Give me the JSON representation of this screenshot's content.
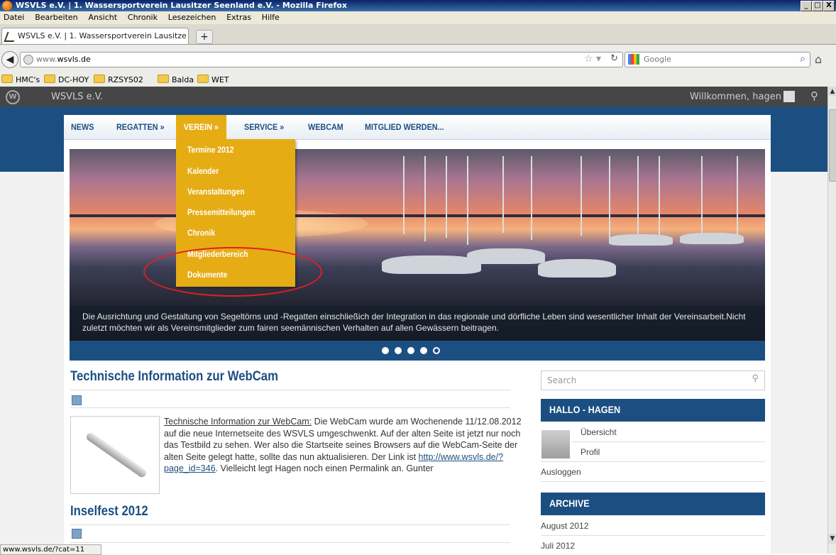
{
  "window": {
    "title": "WSVLS e.V. | 1. Wassersportverein Lausitzer Seenland e.V. - Mozilla Firefox",
    "controls": [
      "_",
      "□",
      "X"
    ]
  },
  "menubar": [
    "Datei",
    "Bearbeiten",
    "Ansicht",
    "Chronik",
    "Lesezeichen",
    "Extras",
    "Hilfe"
  ],
  "tab": {
    "label": "WSVLS e.V. | 1. Wassersportverein Lausitze...",
    "new_tab": "+"
  },
  "urlbar": {
    "prefix": "www.",
    "domain": "wsvls.de"
  },
  "searchbar": {
    "placeholder": "Google"
  },
  "bookmarks": [
    "HMC's",
    "DC-HOY",
    "RZSYS02",
    "Balda",
    "WET"
  ],
  "adminbar": {
    "logo": "W",
    "site": "WSVLS e.V.",
    "welcome": "Willkommen, hagen"
  },
  "nav": {
    "items": [
      "NEWS",
      "REGATTEN »",
      "VEREIN »",
      "SERVICE »",
      "WEBCAM",
      "MITGLIED WERDEN..."
    ],
    "dropdown": [
      "Termine 2012",
      "Kalender",
      "Veranstaltungen",
      "Pressemitteilungen",
      "Chronik",
      "Mitgliederbereich",
      "Dokumente"
    ]
  },
  "slider": {
    "caption": "Die Ausrichtung und Gestaltung von Segeltörns und -Regatten einschließich der Integration in das regionale und dörfliche Leben sind wesentlicher Inhalt der Vereinsarbeit.Nicht zuletzt möchten wir als Vereinsmitglieder zum fairen seemännischen Verhalten auf allen Gewässern beitragen."
  },
  "post1": {
    "title": "Technische Information zur WebCam",
    "link": "Technische Information zur WebCam:",
    "text1": " Die WebCam wurde am Wochenende 11/12.08.2012 auf die neue Internetseite des WSVLS umgeschwenkt. Auf der alten Seite ist jetzt nur noch das Testbild zu sehen. Wer also die Startseite seines Browsers auf die WebCam-Seite der alten Seite gelegt hatte, sollte das nun aktualisieren. Der Link ist ",
    "url": "http://www.wsvls.de/?page_id=346",
    "text2": ".  Vielleicht legt Hagen noch einen Permalink an. Gunter"
  },
  "post2": {
    "title": "Inselfest 2012"
  },
  "sidebar": {
    "search_placeholder": "Search",
    "hallo_title": "HALLO - HAGEN",
    "overview": "Übersicht",
    "profile": "Profil",
    "logout": "Ausloggen",
    "archive_title": "ARCHIVE",
    "archive": [
      "August 2012",
      "Juli 2012"
    ]
  },
  "statusbar": "www.wsvls.de/?cat=11"
}
